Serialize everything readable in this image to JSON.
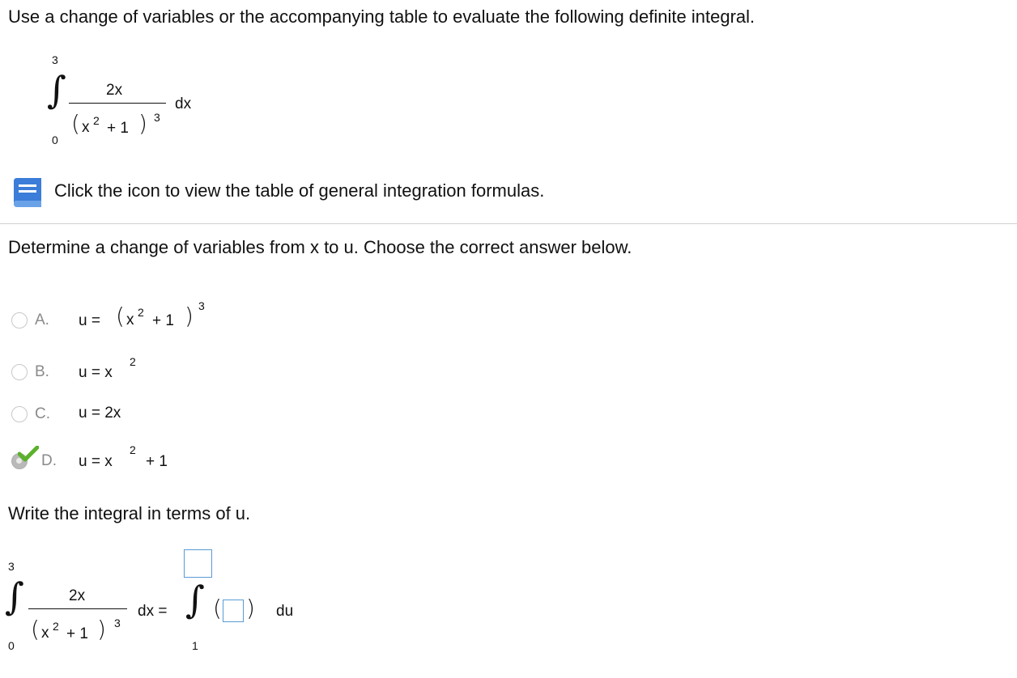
{
  "question": "Use a change of variables or the accompanying table to evaluate the following definite integral.",
  "integral": {
    "upper": "3",
    "lower": "0",
    "numerator": "2x",
    "den_x": "x",
    "den_sq": "2",
    "den_plus": "+ 1",
    "den_pow": "3",
    "dx": "dx"
  },
  "help_link": "Click the icon to view the table of general integration formulas.",
  "prompt1": "Determine a change of variables from x to u. Choose the correct answer below.",
  "choices": [
    {
      "letter": "A.",
      "u": "u =",
      "body": "(x² + 1)³",
      "selected": false
    },
    {
      "letter": "B.",
      "u": "u = x",
      "sup": "2",
      "selected": false
    },
    {
      "letter": "C.",
      "u": "u = 2x",
      "selected": false
    },
    {
      "letter": "D.",
      "u": "u = x",
      "sup": "2",
      "tail": "+ 1",
      "selected": true
    }
  ],
  "choice_a": {
    "lead": "u =",
    "x": "x",
    "sq": "2",
    "plus": "+ 1",
    "pow": "3"
  },
  "prompt2": "Write the integral in terms of u.",
  "answer": {
    "upper": "3",
    "lower": "0",
    "numerator": "2x",
    "den_x": "x",
    "den_sq": "2",
    "den_plus": "+ 1",
    "den_pow": "3",
    "dx_eq": "dx =",
    "u_lower": "1",
    "du": "du"
  },
  "colors": {
    "accent": "#3b7dd8",
    "check": "#5cb12c",
    "input_border": "#5a9bd6"
  }
}
